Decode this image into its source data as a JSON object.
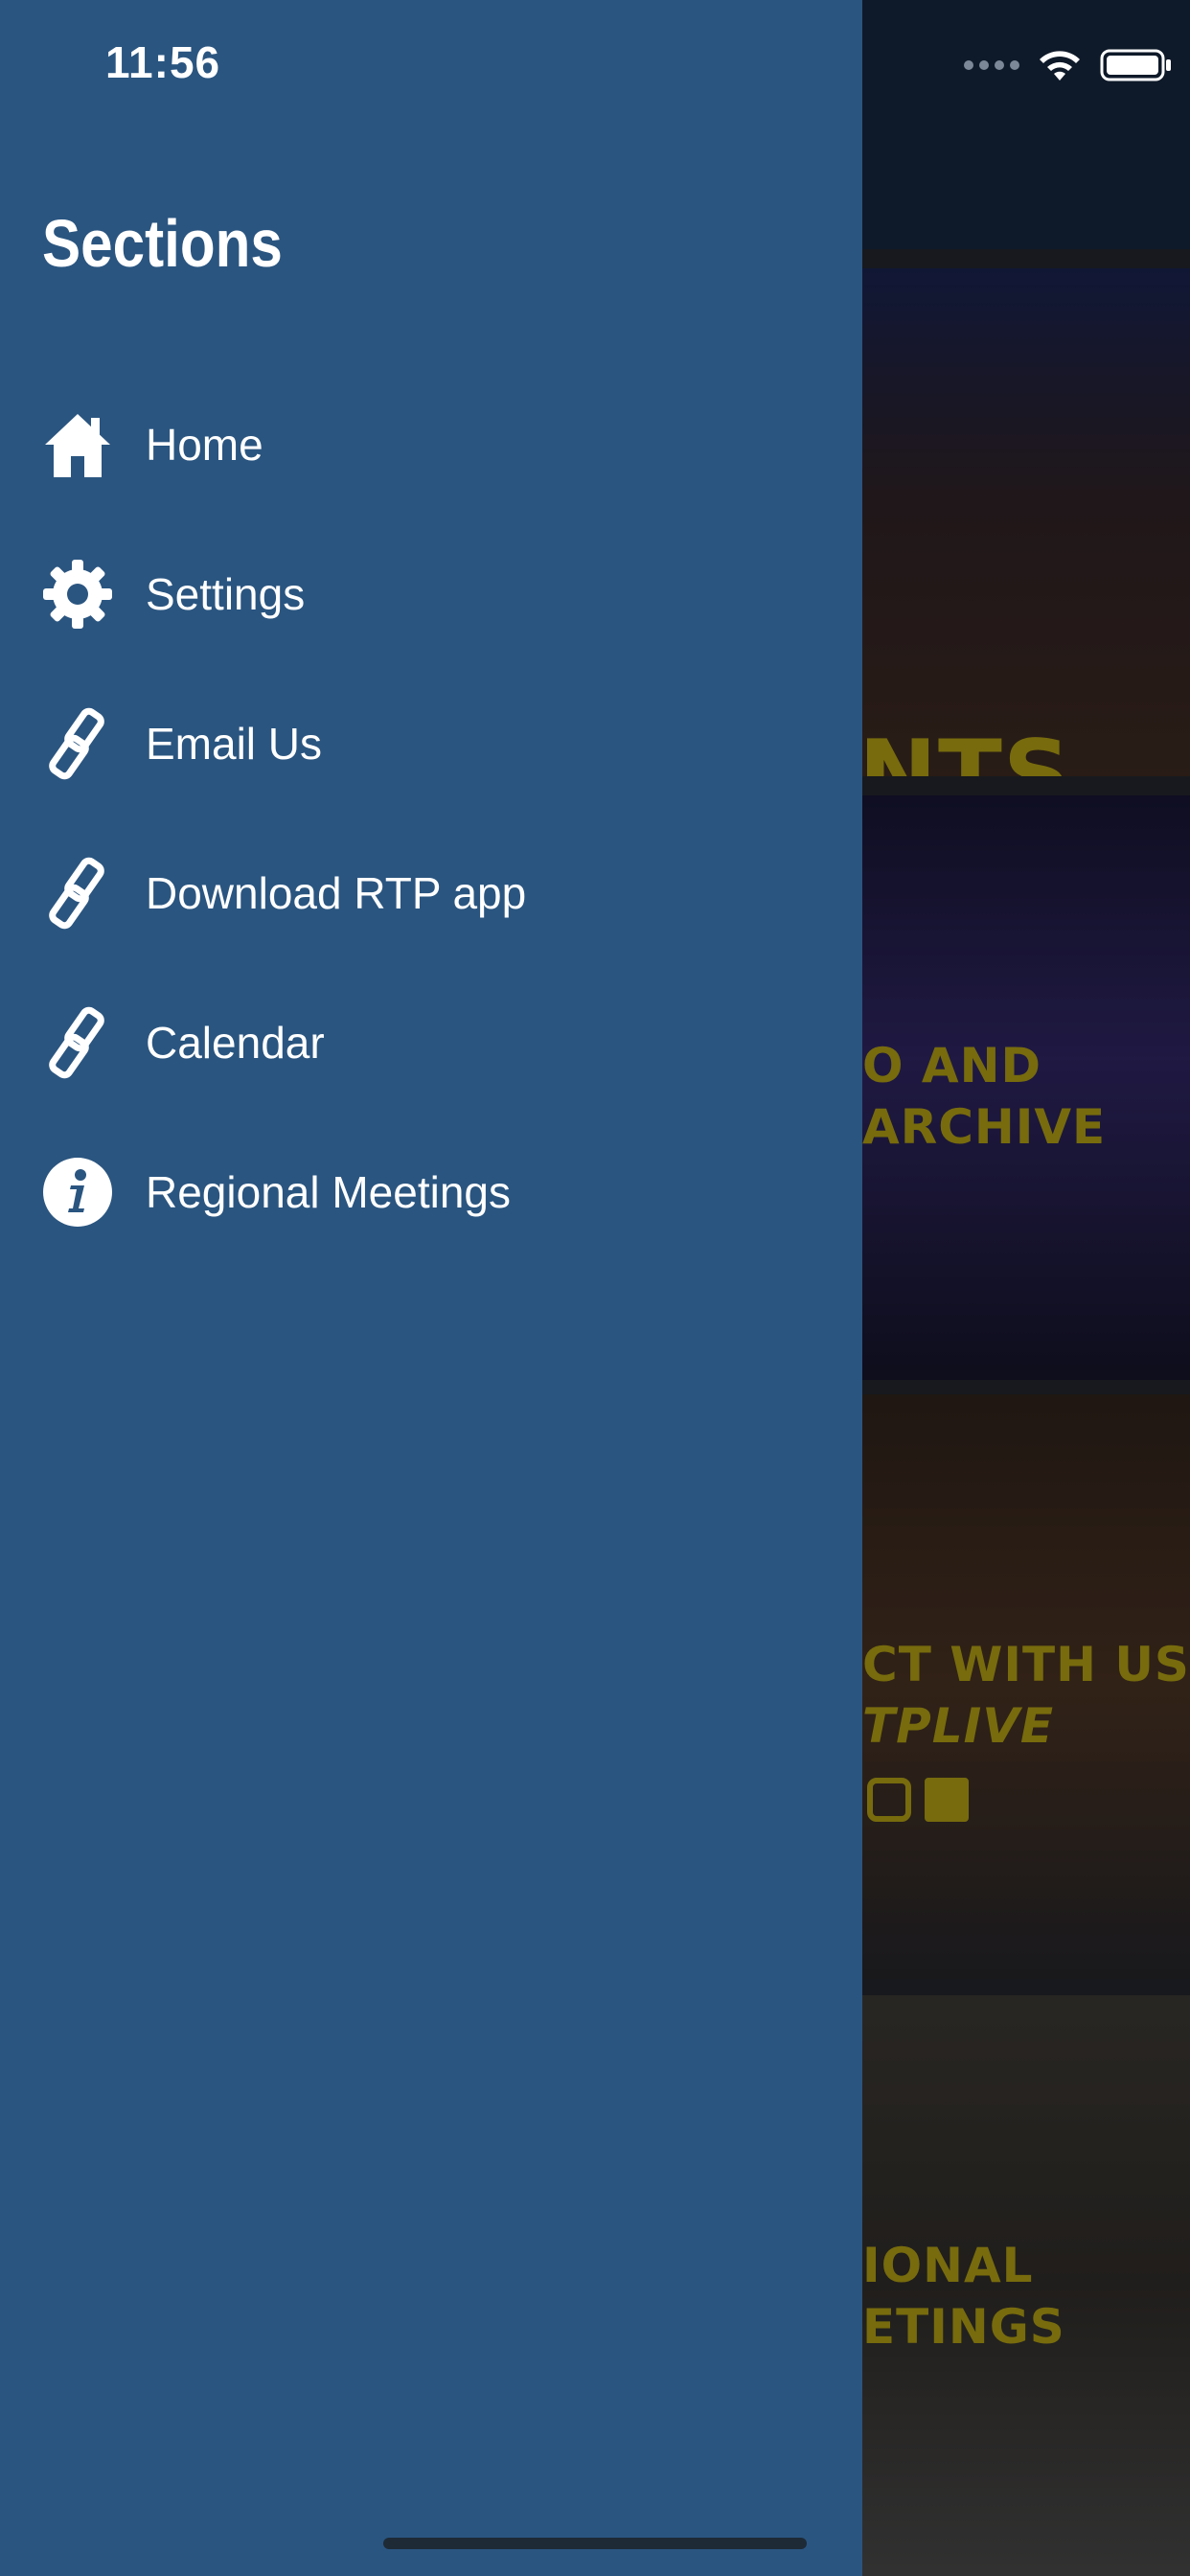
{
  "status_bar": {
    "time": "11:56"
  },
  "drawer": {
    "title": "Sections",
    "items": [
      {
        "label": "Home",
        "icon": "home-icon"
      },
      {
        "label": "Settings",
        "icon": "gear-icon"
      },
      {
        "label": "Email Us",
        "icon": "link-icon"
      },
      {
        "label": "Download RTP app",
        "icon": "link-icon"
      },
      {
        "label": "Calendar",
        "icon": "link-icon"
      },
      {
        "label": "Regional Meetings",
        "icon": "info-icon"
      }
    ]
  },
  "background_tiles": [
    {
      "title": "NTS"
    },
    {
      "line1": "O AND",
      "line2": "ARCHIVE"
    },
    {
      "line1": "CT WITH US",
      "line2": "TPLIVE"
    },
    {
      "line1": "IONAL",
      "line2": "ETINGS"
    }
  ],
  "colors": {
    "drawer_bg": "#2A5580",
    "accent_yellow": "#D9C318",
    "header_bg": "#1A2F4C"
  }
}
